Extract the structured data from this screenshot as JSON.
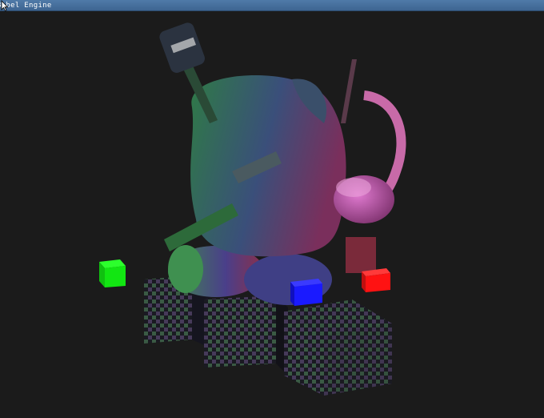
{
  "window": {
    "title": "Bobel Engine",
    "background": "#1b1b1b",
    "titlebar_color": "#3e6591"
  },
  "scene": {
    "light_cubes": [
      {
        "name": "green-light-cube",
        "color": "#12e612"
      },
      {
        "name": "blue-light-cube",
        "color": "#1a1aff"
      },
      {
        "name": "red-light-cube",
        "color": "#ff1212"
      }
    ]
  },
  "icons": {
    "cursor": "mouse-pointer-icon"
  }
}
